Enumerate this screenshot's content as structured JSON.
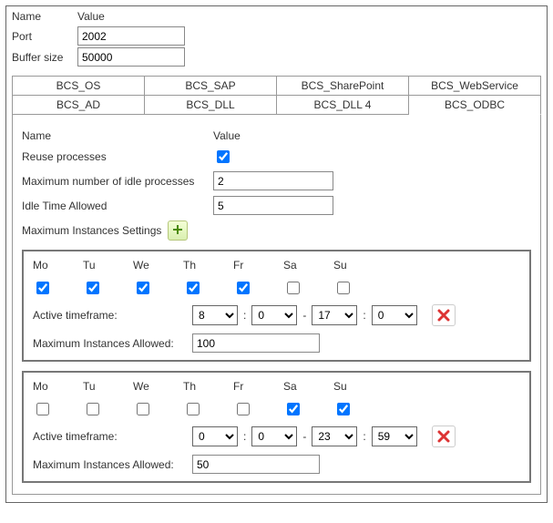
{
  "header": {
    "name_label": "Name",
    "value_label": "Value",
    "port_label": "Port",
    "port_value": "2002",
    "buffer_label": "Buffer size",
    "buffer_value": "50000"
  },
  "tabs_row1": [
    "BCS_OS",
    "BCS_SAP",
    "BCS_SharePoint",
    "BCS_WebService"
  ],
  "tabs_row2": [
    "BCS_AD",
    "BCS_DLL",
    "BCS_DLL 4",
    "BCS_ODBC"
  ],
  "active_tab": "BCS_ODBC",
  "panel": {
    "name_label": "Name",
    "value_label": "Value",
    "reuse_label": "Reuse processes",
    "reuse_checked": true,
    "max_idle_label": "Maximum number of idle processes",
    "max_idle_value": "2",
    "idle_time_label": "Idle Time Allowed",
    "idle_time_value": "5",
    "max_inst_settings_label": "Maximum Instances Settings",
    "days": [
      "Mo",
      "Tu",
      "We",
      "Th",
      "Fr",
      "Sa",
      "Su"
    ],
    "active_timeframe_label": "Active timeframe:",
    "max_instances_label": "Maximum Instances Allowed:",
    "colon": ":",
    "dash": "-",
    "slots": [
      {
        "days_checked": [
          true,
          true,
          true,
          true,
          true,
          false,
          false
        ],
        "from_h": "8",
        "from_m": "0",
        "to_h": "17",
        "to_m": "0",
        "max_instances": "100"
      },
      {
        "days_checked": [
          false,
          false,
          false,
          false,
          false,
          true,
          true
        ],
        "from_h": "0",
        "from_m": "0",
        "to_h": "23",
        "to_m": "59",
        "max_instances": "50"
      }
    ]
  }
}
